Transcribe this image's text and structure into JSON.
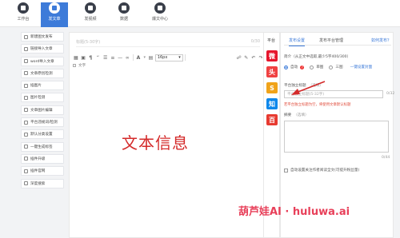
{
  "topnav": {
    "items": [
      {
        "label": "工作台",
        "icon": "desk-icon",
        "active": false
      },
      {
        "label": "发文章",
        "icon": "edit-icon",
        "active": true
      },
      {
        "label": "发视频",
        "icon": "video-icon",
        "active": false
      },
      {
        "label": "数据",
        "icon": "chart-icon",
        "active": false
      },
      {
        "label": "爆文中心",
        "icon": "fire-icon",
        "active": false
      }
    ]
  },
  "sidebar": {
    "items": [
      {
        "label": "新建图文发布"
      },
      {
        "label": "链接导入文章"
      },
      {
        "label": "word导入文章"
      },
      {
        "label": "文章原创检测"
      },
      {
        "label": "插图片"
      },
      {
        "label": "图片检测"
      },
      {
        "label": "文章图片编辑"
      },
      {
        "label": "平台违规词/检测"
      },
      {
        "label": "默认分类设置"
      },
      {
        "label": "一键生成标签"
      },
      {
        "label": "插件升级"
      },
      {
        "label": "插件官网"
      },
      {
        "label": "深度搜索"
      }
    ]
  },
  "editor": {
    "title_placeholder": "标题(5-30字)",
    "title_count": "0/30",
    "font_size": "16px",
    "sub_label": "文字",
    "overlay_text": "文本信息"
  },
  "platforms": {
    "label": "平台",
    "items": [
      {
        "name": "weibo-icon",
        "glyph": "微",
        "color": "#e6162d"
      },
      {
        "name": "toutiao-icon",
        "glyph": "头",
        "color": "#f04142"
      },
      {
        "name": "sohu-icon",
        "glyph": "S",
        "color": "#f0a31a"
      },
      {
        "name": "zhihu-icon",
        "glyph": "知",
        "color": "#0f88eb"
      },
      {
        "name": "baijia-icon",
        "glyph": "百",
        "color": "#e73a30"
      }
    ]
  },
  "panel": {
    "tabs": [
      "发布设置",
      "发布平台管理"
    ],
    "help_link": "如何发布？",
    "summary_hint": "简介（从正文中选取,最少5字400/300）",
    "cover_options": [
      "自动",
      "单图",
      "三图"
    ],
    "one_click_label": "一键设置封面",
    "pt_title_label": "平台独立标题",
    "pt_title_hint": "（选填）",
    "pt_title_placeholder": "平台独立标题(5-32字)",
    "pt_title_count": "0/32",
    "warning": "若平台独立标题为空，将使用文章默认标题",
    "summary_label": "摘要",
    "summary_hint2": "（选填）",
    "summary_count": "0/44",
    "checkbox_label": "自动设置关注作者阅读全文(可提升粉丝量)"
  },
  "watermark": "葫芦娃AI  ·  huluwa.ai",
  "colors": {
    "accent": "#3d7bd9",
    "overlay_text": "#d42a2a",
    "warning": "#e04b3a",
    "watermark": "#e8405a"
  }
}
